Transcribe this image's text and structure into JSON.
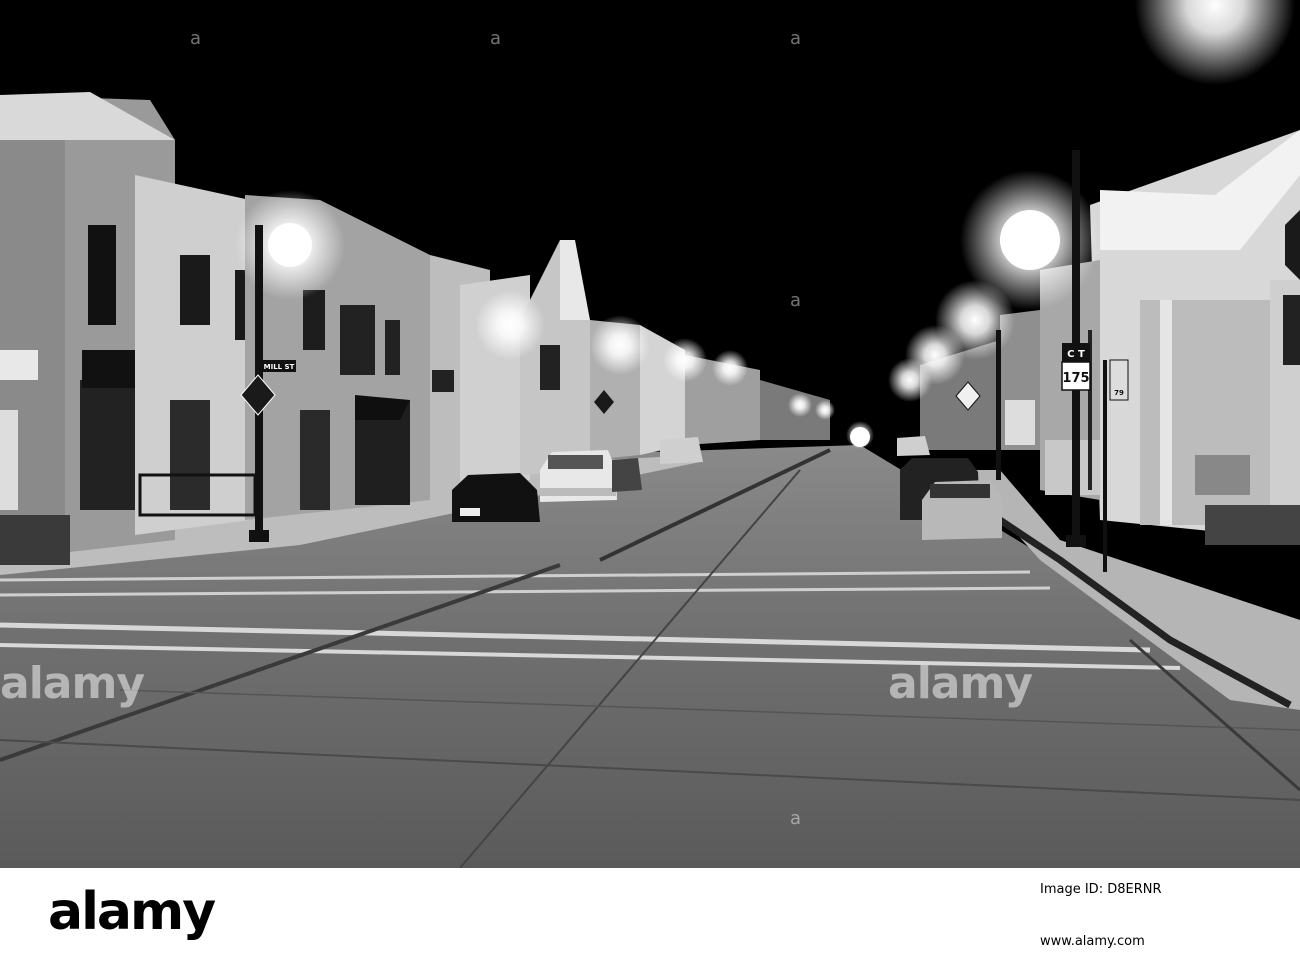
{
  "photo": {
    "street_sign": "MILL ST",
    "route_sign_number": "175",
    "route_sign_top": "C T",
    "bus_sign_number": "79"
  },
  "watermark": {
    "brand": "alamy",
    "overlay_small": [
      "a",
      "a",
      "a",
      "a",
      "a"
    ]
  },
  "footer": {
    "logo": "alamy",
    "image_id_label": "Image ID: D8ERNR",
    "url": "www.alamy.com"
  },
  "colors": {
    "sky": "#000000",
    "road": "#6a6a6a",
    "footer_bg": "#ffffff"
  }
}
